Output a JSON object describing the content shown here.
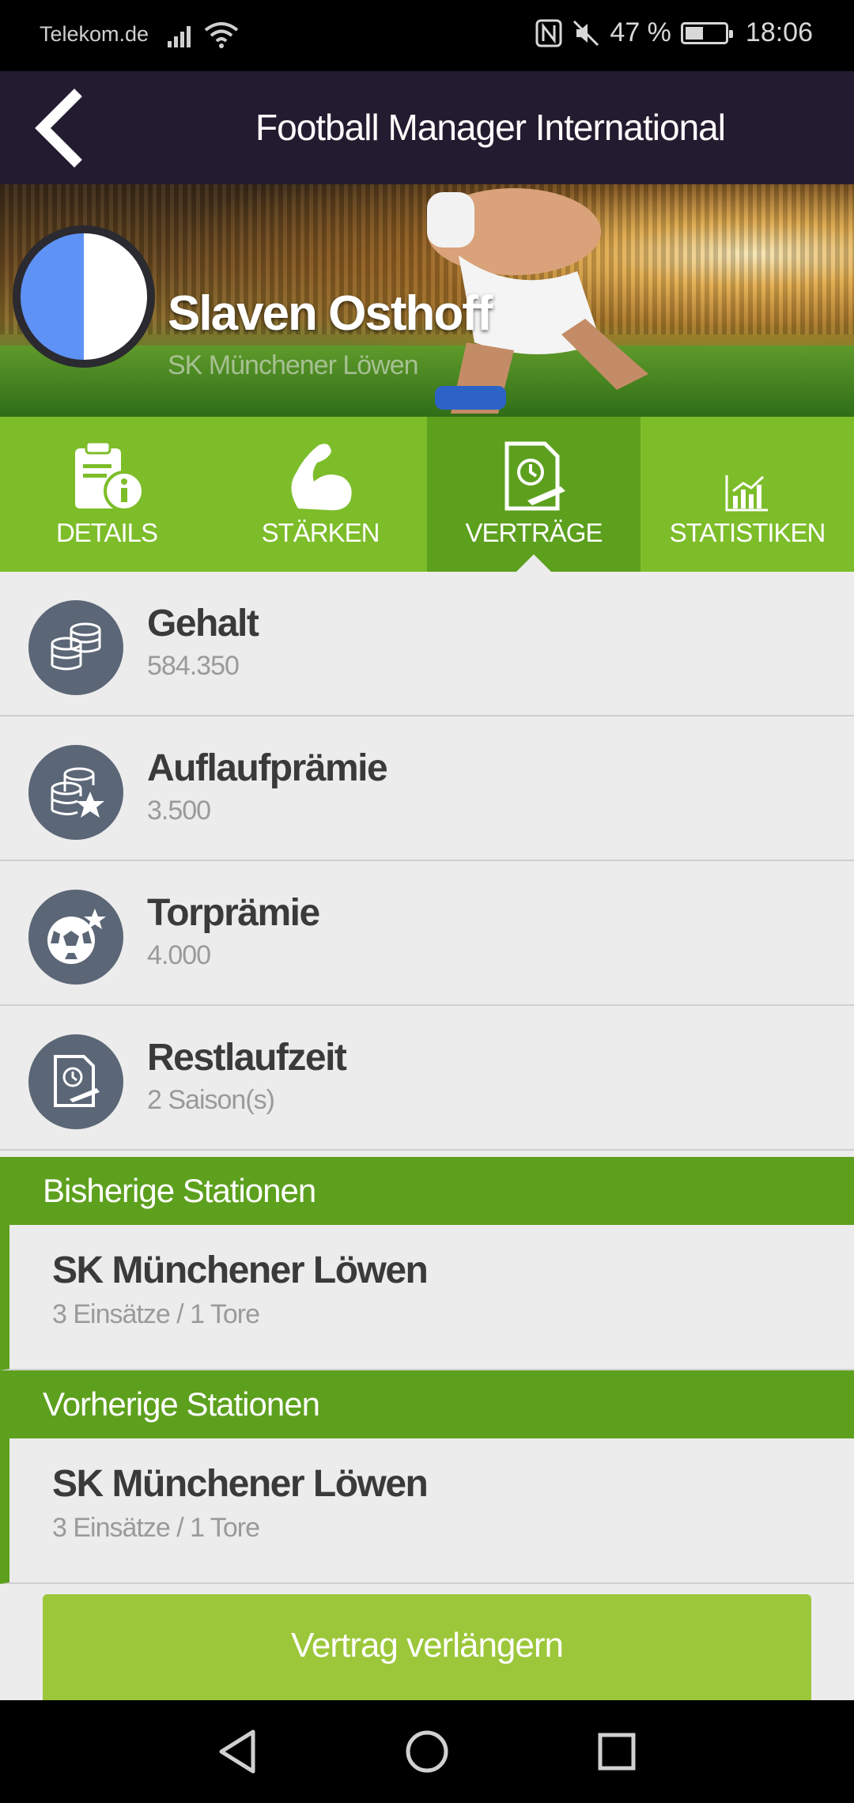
{
  "status_bar": {
    "carrier": "Telekom.de",
    "battery_percent": "47 %",
    "battery_level": 0.47,
    "time": "18:06"
  },
  "app_bar": {
    "title": "Football Manager International"
  },
  "player": {
    "name": "Slaven Osthoff",
    "club": "SK Münchener Löwen",
    "badge_colors": [
      "#5f92f5",
      "#ffffff"
    ]
  },
  "tabs": [
    {
      "label": "DETAILS",
      "icon": "clipboard-info-icon",
      "active": false
    },
    {
      "label": "STÄRKEN",
      "icon": "flexed-arm-icon",
      "active": false
    },
    {
      "label": "VERTRÄGE",
      "icon": "contract-clock-icon",
      "active": true
    },
    {
      "label": "STATISTIKEN",
      "icon": "bar-chart-icon",
      "active": false
    }
  ],
  "contract": [
    {
      "title": "Gehalt",
      "value": "584.350",
      "icon": "coin-stack-icon"
    },
    {
      "title": "Auflaufprämie",
      "value": "3.500",
      "icon": "coins-star-icon"
    },
    {
      "title": "Torprämie",
      "value": "4.000",
      "icon": "football-star-icon"
    },
    {
      "title": "Restlaufzeit",
      "value": "2 Saison(s)",
      "icon": "contract-clock-icon"
    }
  ],
  "sections": [
    {
      "heading": "Bisherige Stationen",
      "station": {
        "club": "SK Münchener Löwen",
        "stats": "3 Einsätze / 1 Tore"
      }
    },
    {
      "heading": "Vorherige Stationen",
      "station": {
        "club": "SK Münchener Löwen",
        "stats": "3 Einsätze / 1 Tore"
      }
    }
  ],
  "cta": {
    "label": "Vertrag verlängern"
  },
  "colors": {
    "app_bar": "#231b2f",
    "green": "#7dbd2a",
    "green_dark": "#5da01e",
    "cta": "#9cc73a",
    "icon_circle": "#5b6676"
  }
}
